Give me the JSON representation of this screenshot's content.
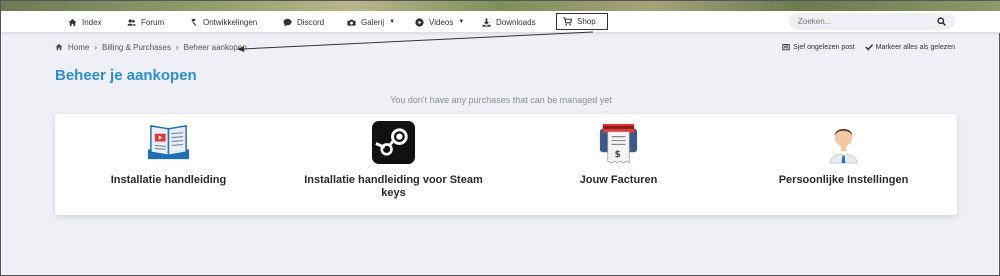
{
  "nav": {
    "items": [
      {
        "label": "Index",
        "icon": "home-icon"
      },
      {
        "label": "Forum",
        "icon": "users-icon"
      },
      {
        "label": "Ontwikkelingen",
        "icon": "hammer-icon"
      },
      {
        "label": "Discord",
        "icon": "chat-icon"
      },
      {
        "label": "Galerij",
        "icon": "camera-icon"
      },
      {
        "label": "Videos",
        "icon": "play-icon"
      },
      {
        "label": "Downloads",
        "icon": "download-icon"
      },
      {
        "label": "Shop",
        "icon": "cart-icon"
      }
    ],
    "search_placeholder": "Zoeken..."
  },
  "breadcrumb": [
    "Home",
    "Billing & Purchases",
    "Beheer aankopen"
  ],
  "actions": {
    "unread": "Sjef ongelezen post",
    "mark_read": "Markeer alles als gelezen"
  },
  "page_title": "Beheer je aankopen",
  "notice": "You don't have any purchases that can be managed yet",
  "tiles": [
    {
      "label": "Installatie handleiding",
      "icon": "book-icon"
    },
    {
      "label": "Installatie handleiding voor Steam keys",
      "icon": "steam-icon"
    },
    {
      "label": "Jouw Facturen",
      "icon": "invoice-icon"
    },
    {
      "label": "Persoonlijke Instellingen",
      "icon": "person-icon"
    }
  ],
  "colors": {
    "accent": "#2b8ed8",
    "background": "#eef0f5"
  }
}
